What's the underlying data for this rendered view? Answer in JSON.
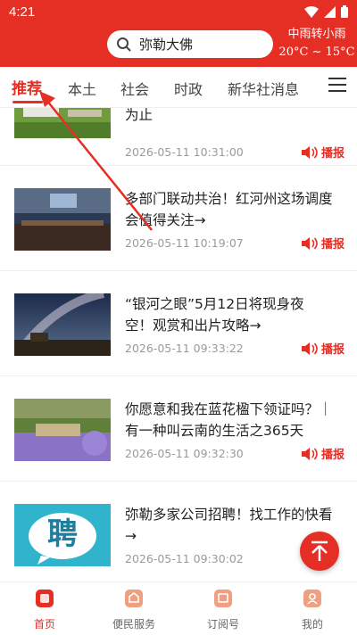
{
  "status_bar": {
    "time": "4:21"
  },
  "search": {
    "text": "弥勒大佛"
  },
  "weather": {
    "condition": "中雨转小雨",
    "temperature": "20°C ~ 15°C"
  },
  "tabs": [
    {
      "label": "推荐",
      "active": true
    },
    {
      "label": "本土",
      "active": false
    },
    {
      "label": "社会",
      "active": false
    },
    {
      "label": "时政",
      "active": false
    },
    {
      "label": "新华社消息",
      "active": false
    }
  ],
  "feed": [
    {
      "title_lines": [
        "为止"
      ],
      "time": "2026-05-11 10:31:00",
      "audio_label": "播报"
    },
    {
      "title_lines": [
        "多部门联动共治！红河州这场调度",
        "会值得关注→"
      ],
      "time": "2026-05-11 10:19:07",
      "audio_label": "播报"
    },
    {
      "title_lines": [
        "“银河之眼”5月12日将现身夜",
        "空！观赏和出片攻略→"
      ],
      "time": "2026-05-11 09:33:22",
      "audio_label": "播报"
    },
    {
      "title_lines": [
        "你愿意和我在蓝花楹下领证吗？｜",
        "有一种叫云南的生活之365天"
      ],
      "time": "2026-05-11 09:32:30",
      "audio_label": "播报"
    },
    {
      "title_lines": [
        "弥勒多家公司招聘！找工作的快看",
        "→"
      ],
      "time": "2026-05-11 09:30:02",
      "audio_label": "",
      "thumb_text": "聘"
    }
  ],
  "bottom_nav": [
    {
      "label": "首页",
      "active": true
    },
    {
      "label": "便民服务",
      "active": false
    },
    {
      "label": "订阅号",
      "active": false
    },
    {
      "label": "我的",
      "active": false
    }
  ],
  "colors": {
    "brand": "#e52e24"
  }
}
